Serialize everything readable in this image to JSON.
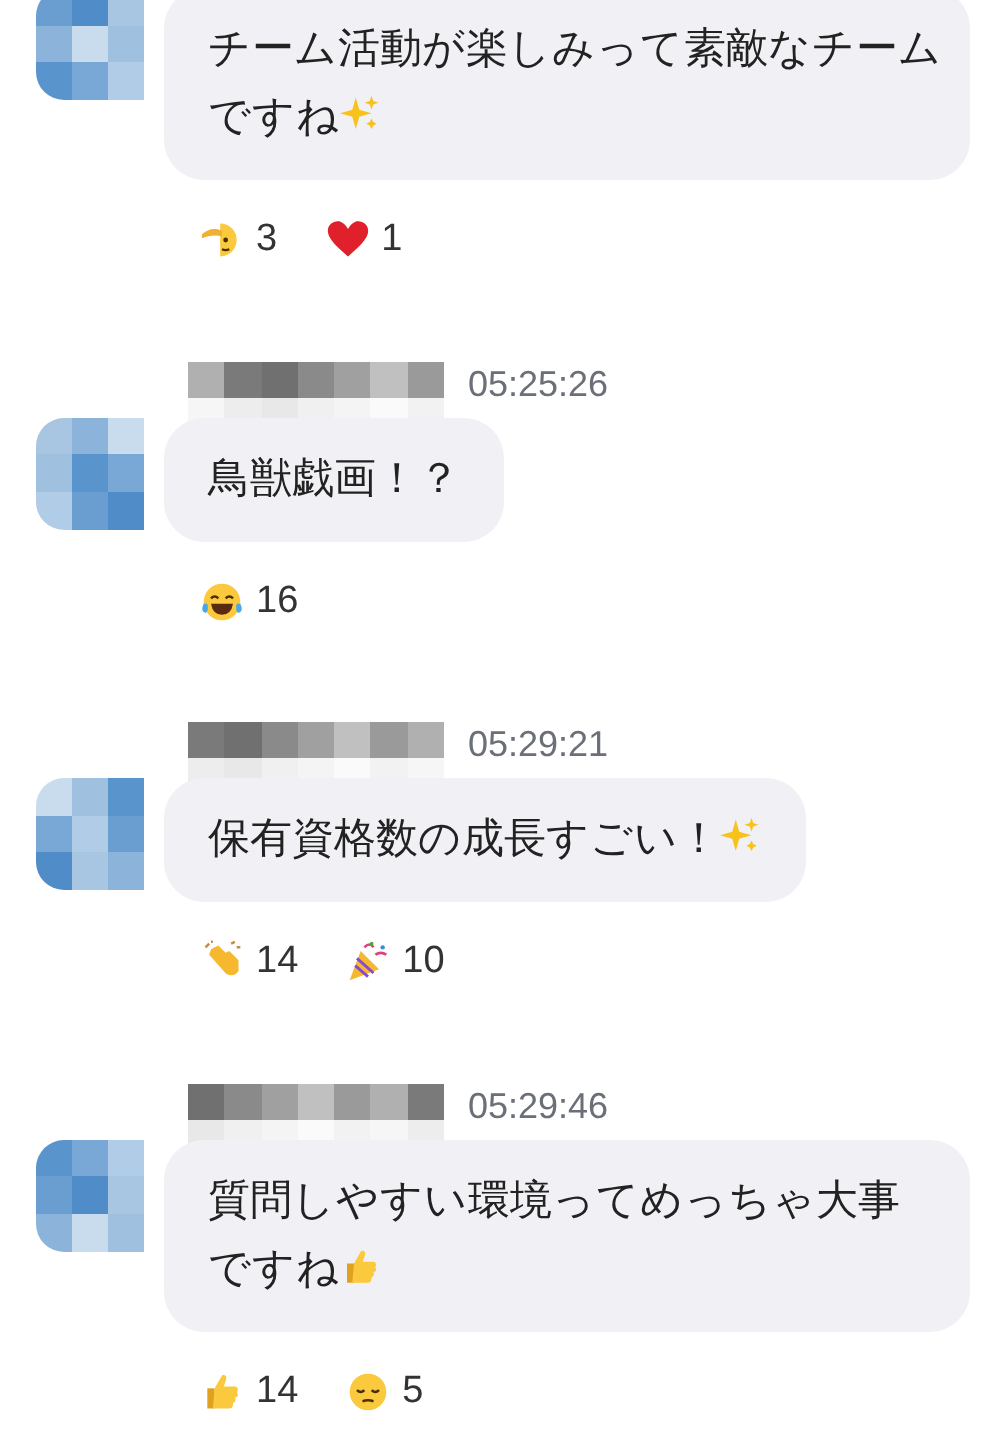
{
  "messages": [
    {
      "lines": [
        "チーム活動が楽しみって素敵なチーム",
        "ですね"
      ],
      "trailing_emoji": {
        "kind": "sparkles"
      },
      "reactions": [
        {
          "kind": "salute",
          "count": "3"
        },
        {
          "kind": "heart",
          "count": "1"
        }
      ]
    },
    {
      "time": "05:25:26",
      "lines": [
        "鳥獣戯画！？"
      ],
      "reactions": [
        {
          "kind": "joy",
          "count": "16"
        }
      ]
    },
    {
      "time": "05:29:21",
      "lines": [
        "保有資格数の成長すごい！"
      ],
      "trailing_emoji": {
        "kind": "sparkles"
      },
      "reactions": [
        {
          "kind": "clap",
          "count": "14"
        },
        {
          "kind": "party",
          "count": "10"
        }
      ]
    },
    {
      "time": "05:29:46",
      "lines": [
        "質問しやすい環境ってめっちゃ大事",
        "ですね"
      ],
      "trailing_emoji": {
        "kind": "thumbs-up"
      },
      "reactions": [
        {
          "kind": "thumbs-up",
          "count": "14"
        },
        {
          "kind": "pensive",
          "count": "5"
        }
      ]
    }
  ]
}
